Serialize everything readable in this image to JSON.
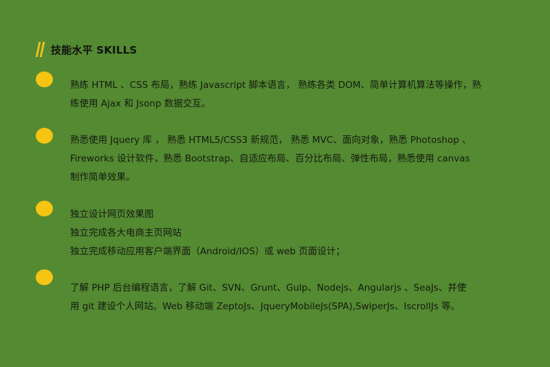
{
  "header": {
    "title": "技能水平 SKILLS",
    "icon": "double-slash-icon",
    "accent_color": "#f2c21a"
  },
  "background_color": "#548a32",
  "skills": [
    {
      "lines": [
        "熟练 HTML 、CSS 布局，熟练 Javascript 脚本语言， 熟练各类 DOM、简单计算机算法等操作，熟",
        "练使用 Ajax 和 Jsonp 数据交互。"
      ]
    },
    {
      "lines": [
        "熟悉使用 Jquery 库 ， 熟悉 HTML5/CSS3 新规范， 熟悉 MVC、面向对象，熟悉 Photoshop 、",
        "Fireworks 设计软件，熟悉 Bootstrap、自适应布局、百分比布局、弹性布局，熟悉使用 canvas",
        "制作简单效果。"
      ]
    },
    {
      "lines": [
        "独立设计网页效果图",
        "独立完成各大电商主页网站",
        "独立完成移动应用客户端界面（Android/IOS）或 web 页面设计；"
      ]
    },
    {
      "lines": [
        "了解 PHP 后台编程语言，了解 Git、SVN、Grunt、Gulp、Nodejs、Angularjs 、SeaJs、并使",
        "用 git 建设个人网站。Web 移动端 ZeptoJs、JqueryMobileJs(SPA),SwiperJs、IscrollJs 等。"
      ]
    }
  ]
}
